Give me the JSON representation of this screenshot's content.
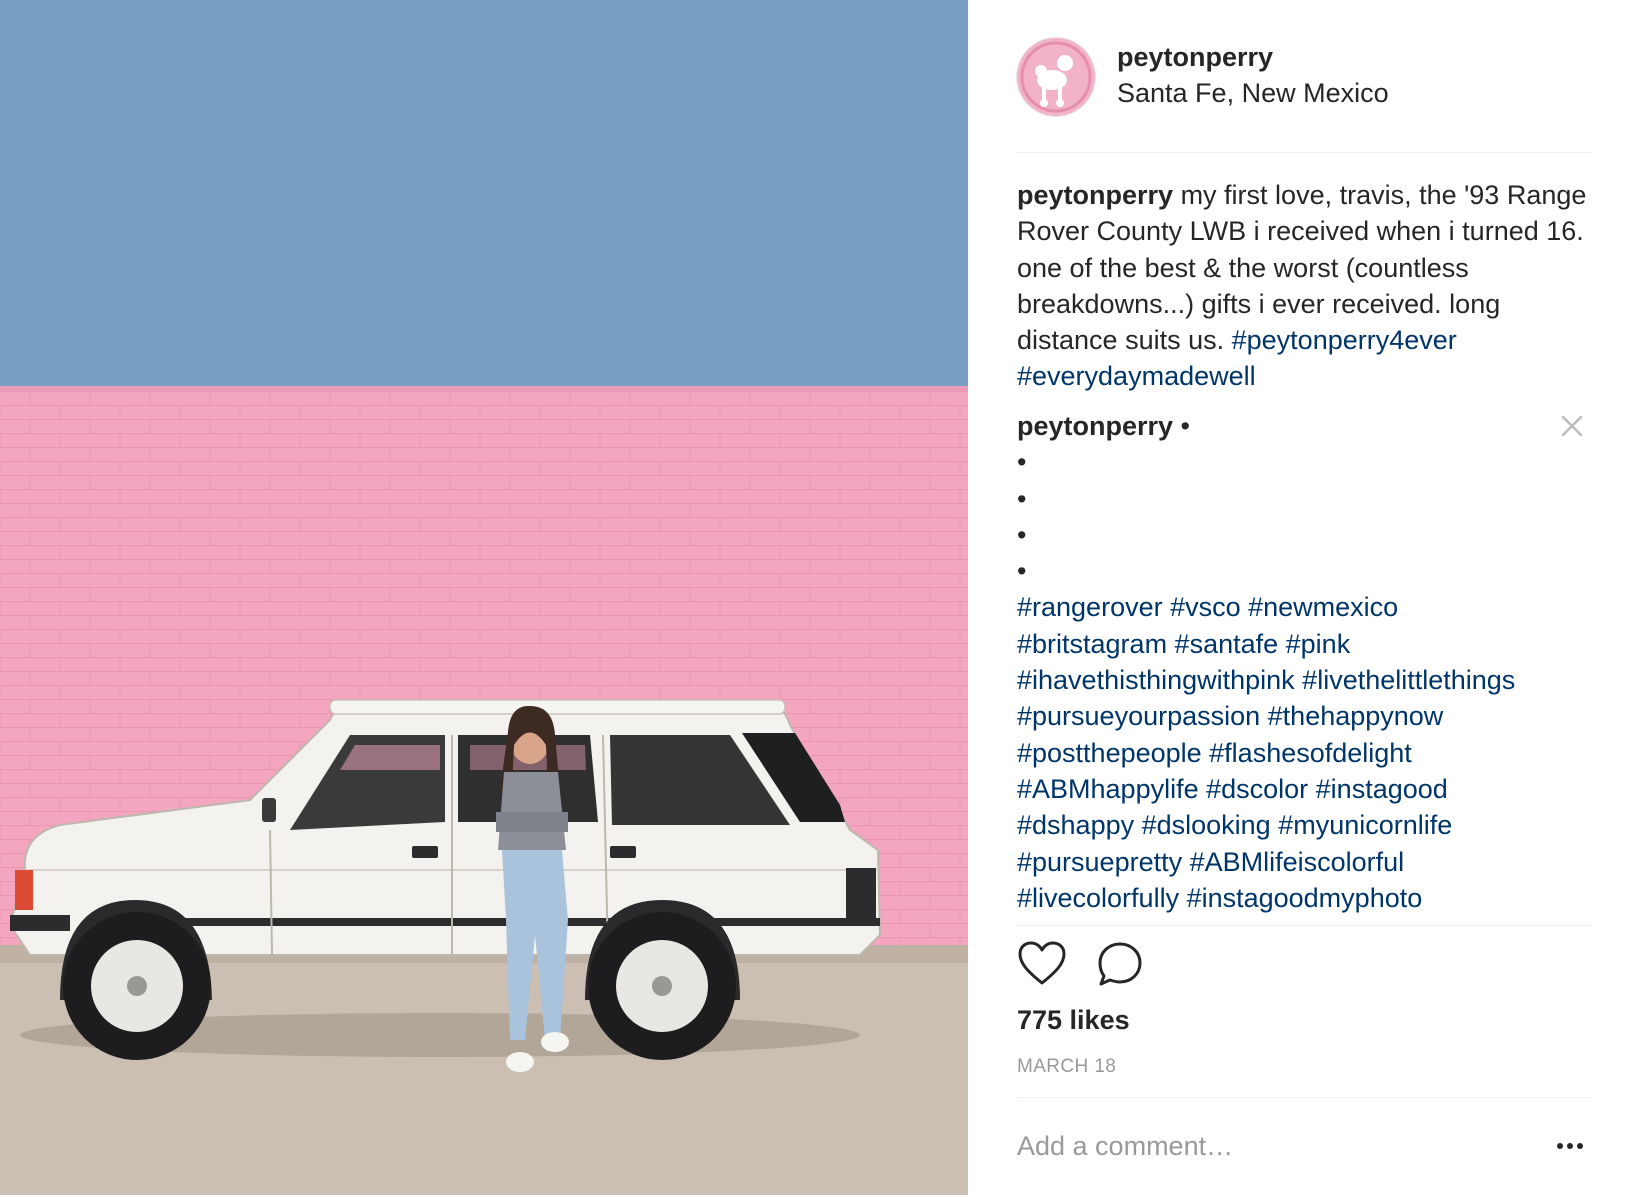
{
  "post": {
    "username": "peytonperry",
    "location": "Santa Fe, New Mexico",
    "caption": {
      "username": "peytonperry",
      "text": "my first love, travis, the '93 Range Rover County LWB i received when i turned 16. one of the best & the worst (countless breakdowns...) gifts i ever received. long distance suits us.",
      "hashtags": "#peytonperry4ever #everydaymadewell"
    },
    "comment": {
      "username": "peytonperry",
      "dot": " •",
      "bullets": [
        "•",
        "•",
        "•",
        "•"
      ],
      "hashtag_lines": [
        "#rangerover #vsco #newmexico",
        "#britstagram #santafe #pink",
        "#ihavethisthingwithpink #livethelittlethings",
        "#pursueyourpassion #thehappynow",
        "#postthepeople #flashesofdelight",
        "#ABMhappylife #dscolor #instagood",
        "#dshappy #dslooking #myunicornlife",
        "#pursuepretty #ABMlifeiscolorful",
        "#livecolorfully #instagoodmyphoto"
      ]
    },
    "likes": "775 likes",
    "date": "MARCH 18",
    "add_comment_placeholder": "Add a comment…",
    "icons": {
      "like": "heart-icon",
      "comment": "comment-bubble-icon",
      "more": "more-options-icon",
      "close": "close-icon"
    },
    "photo": {
      "description_icon": "post-photo",
      "sky_color": "#7a9fc4",
      "wall_color": "#f4a6c0",
      "ground_color": "#cbbfb3",
      "car_color": "#f4f2ee"
    },
    "colors": {
      "text": "#262626",
      "hashtag": "#003569",
      "muted": "#999999",
      "divider": "#efefef"
    }
  }
}
